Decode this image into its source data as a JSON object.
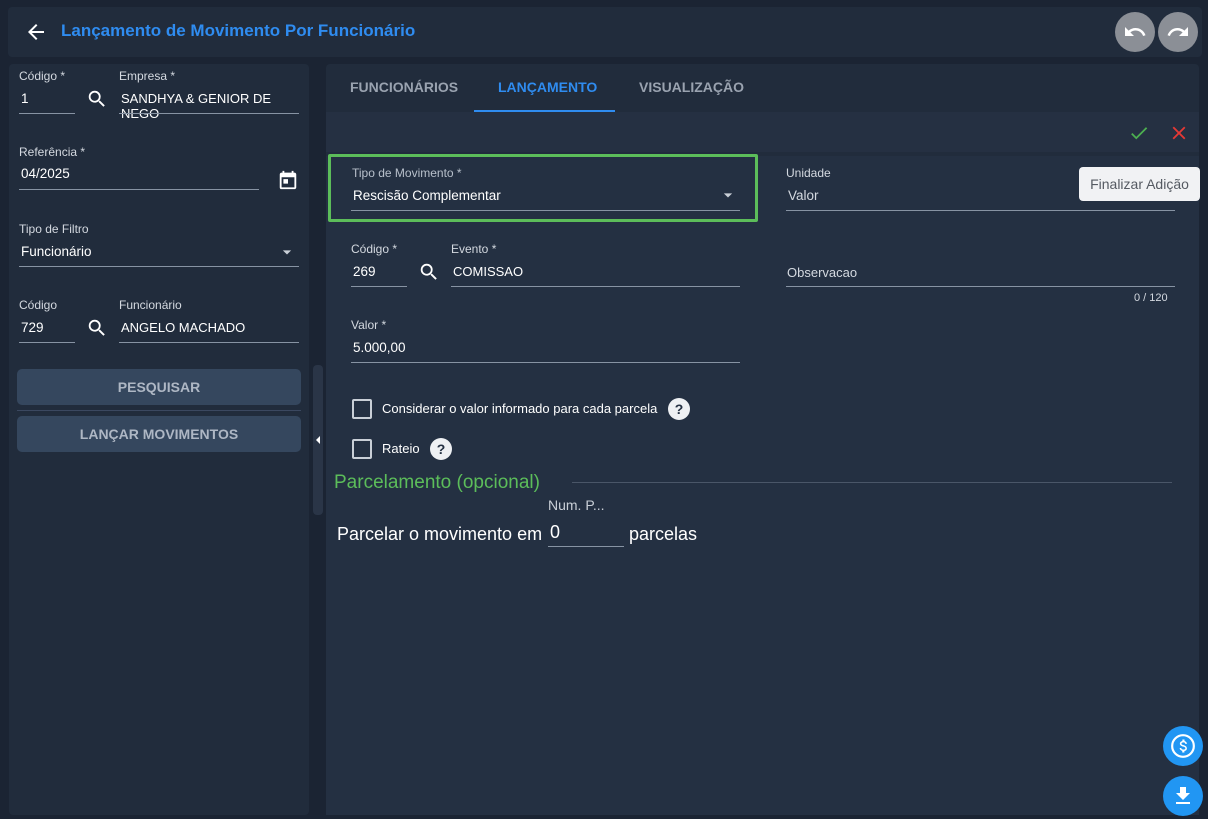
{
  "header": {
    "title": "Lançamento de Movimento Por Funcionário"
  },
  "left": {
    "codigo_label": "Código *",
    "codigo_value": "1",
    "empresa_label": "Empresa *",
    "empresa_value": "SANDHYA & GENIOR DE NEGO",
    "referencia_label": "Referência *",
    "referencia_value": "04/2025",
    "tipo_filtro_label": "Tipo de Filtro",
    "tipo_filtro_value": "Funcionário",
    "codigo2_label": "Código",
    "codigo2_value": "729",
    "funcionario_label": "Funcionário",
    "funcionario_value": "ANGELO MACHADO",
    "pesquisar_label": "PESQUISAR",
    "lancar_label": "LANÇAR MOVIMENTOS"
  },
  "tabs": [
    "FUNCIONÁRIOS",
    "LANÇAMENTO",
    "VISUALIZAÇÃO"
  ],
  "form": {
    "tipo_mov_label": "Tipo de Movimento *",
    "tipo_mov_value": "Rescisão Complementar",
    "unidade_label": "Unidade",
    "unidade_value": "Valor",
    "codigo_label": "Código *",
    "codigo_value": "269",
    "evento_label": "Evento *",
    "evento_value": "COMISSAO",
    "observacao_placeholder": "Observacao",
    "observacao_counter": "0 / 120",
    "valor_label": "Valor *",
    "valor_value": "5.000,00",
    "considerar_label": "Considerar o valor informado para cada parcela",
    "rateio_label": "Rateio",
    "help_glyph": "?",
    "parcelamento_title": "Parcelamento (opcional)",
    "num_p_label": "Num. P...",
    "parcelar_prefix": "Parcelar o movimento em",
    "parcelar_value": "0",
    "parcelar_suffix": "parcelas"
  },
  "tooltip": "Finalizar Adição",
  "colors": {
    "accent": "#2f8cf0",
    "confirm": "#4caf50",
    "cancel": "#e53935",
    "highlight": "#5cbd5a",
    "fab": "#2196f3"
  },
  "icons": [
    "arrow-left-icon",
    "undo-icon",
    "redo-icon",
    "search-icon",
    "calendar-icon",
    "dropdown-icon",
    "check-icon",
    "close-icon",
    "help-icon",
    "dollar-icon",
    "download-icon",
    "chevron-left-icon"
  ]
}
